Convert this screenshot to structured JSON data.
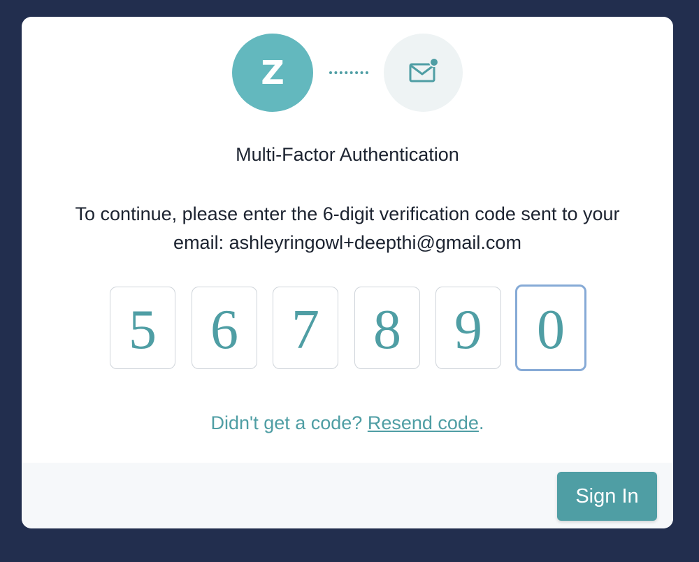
{
  "logo": {
    "letter": "Z"
  },
  "icons": {
    "mail": "mail-notification-icon"
  },
  "title": "Multi-Factor Authentication",
  "description": "To continue, please enter the 6-digit verification code sent to your email: ashleyringowl+deepthi@gmail.com",
  "code": {
    "digits": [
      "5",
      "6",
      "7",
      "8",
      "9",
      "0"
    ],
    "focused_index": 5
  },
  "resend": {
    "prompt": "Didn't get a code? ",
    "link": "Resend code",
    "suffix": "."
  },
  "footer": {
    "signin_label": "Sign In"
  },
  "colors": {
    "background": "#222e4e",
    "accent": "#4f9ea4",
    "logo": "#63b8be",
    "focus_border": "#86aad6"
  }
}
